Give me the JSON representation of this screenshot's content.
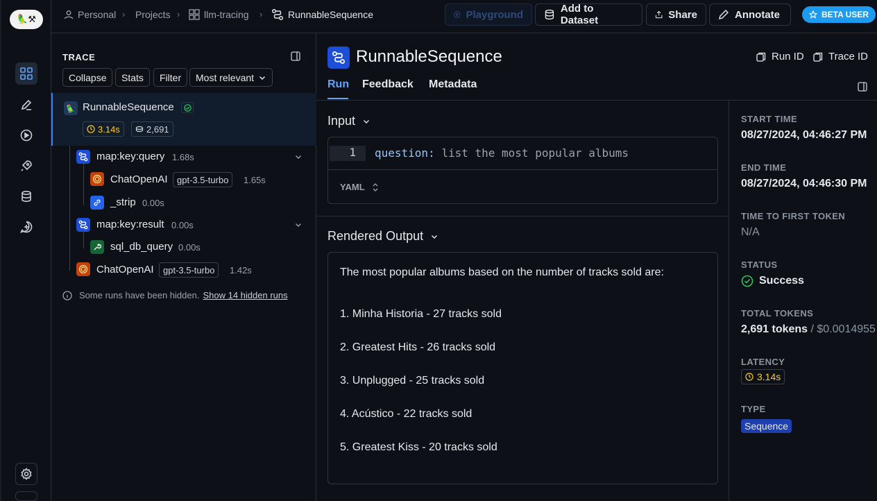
{
  "rail": {
    "logo_label": "🦜⚒",
    "items": [
      {
        "name": "projects-icon"
      },
      {
        "name": "annotate-icon"
      },
      {
        "name": "playground-icon"
      },
      {
        "name": "deploy-icon"
      },
      {
        "name": "datasets-icon"
      },
      {
        "name": "prompts-icon"
      }
    ],
    "settings_icon": "gear-icon"
  },
  "breadcrumb": {
    "items": [
      "Personal",
      "Projects",
      "llm-tracing",
      "RunnableSequence"
    ]
  },
  "toolbar": {
    "playground_label": "Playground",
    "add_dataset_label": "Add to Dataset",
    "share_label": "Share",
    "annotate_label": "Annotate",
    "beta_label": "BETA USER"
  },
  "trace": {
    "title": "TRACE",
    "filters": [
      "Collapse",
      "Stats",
      "Filter",
      "Most relevant"
    ],
    "root": {
      "name": "RunnableSequence",
      "latency": "3.14s",
      "tokens": "2,691"
    },
    "nodes": [
      {
        "name": "map:key:query",
        "time": "1.68s"
      },
      {
        "name": "ChatOpenAI",
        "model": "gpt-3.5-turbo",
        "time": "1.65s"
      },
      {
        "name": "_strip",
        "time": "0.00s"
      },
      {
        "name": "map:key:result",
        "time": "0.00s"
      },
      {
        "name": "sql_db_query",
        "time": "0.00s"
      },
      {
        "name": "ChatOpenAI",
        "model": "gpt-3.5-turbo",
        "time": "1.42s"
      }
    ],
    "hidden_notice": "Some runs have been hidden.",
    "hidden_link": "Show 14 hidden runs"
  },
  "run": {
    "title": "RunnableSequence",
    "run_id_label": "Run ID",
    "trace_id_label": "Trace ID",
    "tabs": [
      "Run",
      "Feedback",
      "Metadata"
    ],
    "input": {
      "title": "Input",
      "line_no": "1",
      "key": "question:",
      "value": " list the most popular albums",
      "format": "YAML"
    },
    "output": {
      "title": "Rendered Output",
      "lines": [
        "The most popular albums based on the number of tracks sold are:",
        "1. Minha Historia - 27 tracks sold",
        "2. Greatest Hits - 26 tracks sold",
        "3. Unplugged - 25 tracks sold",
        "4. Acústico - 22 tracks sold",
        "5. Greatest Kiss - 20 tracks sold"
      ]
    }
  },
  "details": {
    "start_time_label": "START TIME",
    "start_time": "08/27/2024, 04:46:27 PM",
    "end_time_label": "END TIME",
    "end_time": "08/27/2024, 04:46:30 PM",
    "ttft_label": "TIME TO FIRST TOKEN",
    "ttft": "N/A",
    "status_label": "STATUS",
    "status": "Success",
    "tokens_label": "TOTAL TOKENS",
    "tokens": "2,691 tokens",
    "cost": "/ $0.0014955",
    "latency_label": "LATENCY",
    "latency": "3.14s",
    "type_label": "TYPE",
    "type": "Sequence"
  },
  "colors": {
    "accent": "#60a5fa",
    "success": "#22c55e",
    "latency": "#facc15"
  }
}
